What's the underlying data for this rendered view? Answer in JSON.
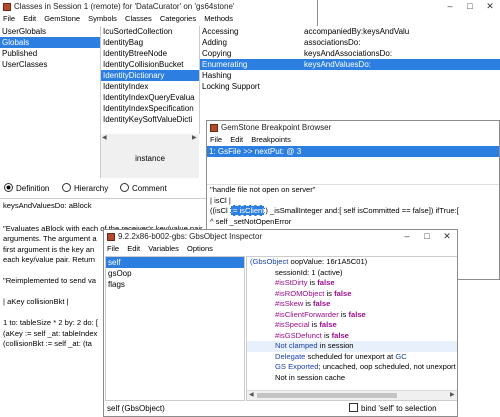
{
  "classes_window": {
    "title": "Classes in Session 1 (remote) for 'DataCurator' on 'gs64stone'",
    "menus": [
      "File",
      "Edit",
      "GemStone",
      "Symbols",
      "Classes",
      "Categories",
      "Methods"
    ],
    "dictionaries": [
      "UserGlobals",
      "Globals",
      "Published",
      "UserClasses"
    ],
    "classes": [
      "IcuSortedCollection",
      "IdentityBag",
      "IdentityBtreeNode",
      "IdentityCollisionBucket",
      "IdentityDictionary",
      "IdentityIndex",
      "IdentityIndexQueryEvalua",
      "IdentityIndexSpecification",
      "IdentityKeySoftValueDicti"
    ],
    "categories": [
      "Accessing",
      "Adding",
      "Copying",
      "Enumerating",
      "Hashing",
      "Locking Support"
    ],
    "methods": [
      "accompaniedBy:keysAndValu",
      "associationsDo:",
      "keysAndAssociationsDo:",
      "keysAndValuesDo:"
    ],
    "instance_label": "instance",
    "radio_definition": "Definition",
    "radio_hierarchy": "Hierarchy",
    "radio_comment": "Comment",
    "code": [
      "keysAndValuesDo: aBlock",
      "",
      "\"Evaluates aBlock with each of the receiver's key/value pair",
      " arguments.  The argument a",
      " first argument is the key an",
      " each key/value pair.  Return",
      "",
      "\"Reimplemented to send va",
      "",
      "| aKey collisionBkt |",
      "",
      "1 to: tableSize * 2 by: 2 do: [",
      "  (aKey := self _at: tableIndex",
      "    (collisionBkt := self _at: (ta"
    ]
  },
  "breakpoint_window": {
    "title": "GemStone Breakpoint Browser",
    "menus": [
      "File",
      "Edit",
      "Breakpoints"
    ],
    "item": "1: GsFile >> nextPut: @ 3",
    "code_1": "\"handle file not open on server\"",
    "code_2": "| isCl |",
    "code_3a": "((isCl ",
    "code_3b": ":= isClient",
    "code_3c": ") _isSmallInteger and:[ self isCommitted == false]) ifTrue:[",
    "code_4": "  ^ self _setNotOpenError"
  },
  "inspector_window": {
    "title": "9.2.2x86-b002-gbs: GbsObject Inspector",
    "menus": [
      "File",
      "Edit",
      "Variables",
      "Options"
    ],
    "variables": [
      "self",
      "gsOop",
      "flags"
    ],
    "footer": "self (GbsObject)",
    "checkbox_label": "bind 'self' to selection",
    "detail_1a": "(GbsObject",
    "detail_1b": " oopValue: 16r1A5C01)",
    "detail_2": "sessionId: 1 (active)",
    "flags": [
      {
        "name": "#isStDirty",
        "is": "is",
        "value": "false"
      },
      {
        "name": "#isROMObject",
        "is": "is",
        "value": "false"
      },
      {
        "name": "#isSkew",
        "is": "is",
        "value": "false"
      },
      {
        "name": "#isClientForwarder",
        "is": "is",
        "value": "false"
      },
      {
        "name": "#isSpecial",
        "is": "is",
        "value": "false"
      },
      {
        "name": "#isGSDefunct",
        "is": "is",
        "value": "false"
      }
    ],
    "clamped_a": "Not clamped",
    "clamped_b": " in session",
    "delegate_a": "Delegate",
    "delegate_b": " scheduled for unexport at ",
    "delegate_c": "GC",
    "exported_a": "GS Exported",
    "exported_b": "; uncached, oop scheduled, not unexport c",
    "cache": "Not in session cache"
  },
  "colors": {
    "selection": "#2c7fe0",
    "keyword": "#9b0d8c",
    "link": "#1a3fa8",
    "icon": "#b34a2e"
  }
}
